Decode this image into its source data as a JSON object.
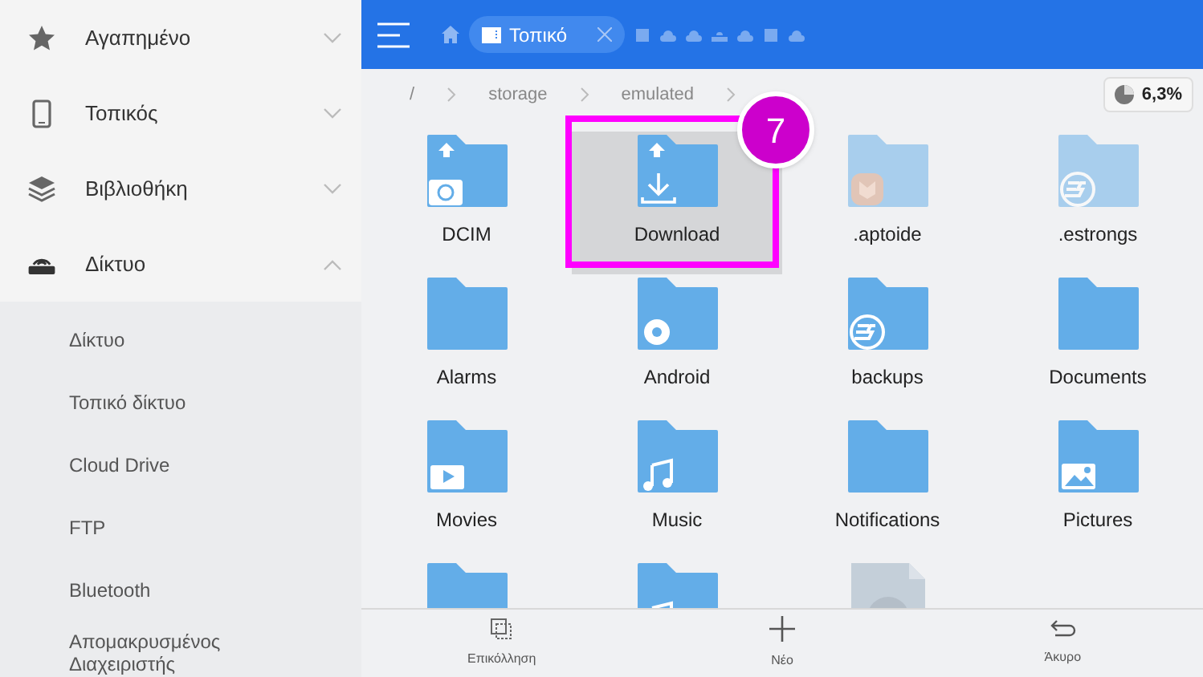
{
  "sidebar": {
    "items": [
      {
        "label": "Αγαπημένο",
        "kind": "star",
        "expanded": false
      },
      {
        "label": "Τοπικός",
        "kind": "phone",
        "expanded": false
      },
      {
        "label": "Βιβλιοθήκη",
        "kind": "layers",
        "expanded": false
      },
      {
        "label": "Δίκτυο",
        "kind": "router",
        "expanded": true,
        "children": [
          {
            "label": "Δίκτυο"
          },
          {
            "label": "Τοπικό δίκτυο"
          },
          {
            "label": "Cloud Drive"
          },
          {
            "label": "FTP"
          },
          {
            "label": "Bluetooth"
          },
          {
            "label": "Απομακρυσμένος Διαχειριστής"
          }
        ]
      }
    ]
  },
  "tab": {
    "label": "Τοπικό"
  },
  "breadcrumb": [
    "/",
    "storage",
    "emulated"
  ],
  "storage_badge": "6,3%",
  "files": [
    {
      "name": "DCIM",
      "kind": "camera",
      "upload": true,
      "hidden": false,
      "selected": false
    },
    {
      "name": "Download",
      "kind": "download",
      "upload": true,
      "hidden": false,
      "selected": true
    },
    {
      "name": ".aptoide",
      "kind": "aptoide",
      "upload": false,
      "hidden": true,
      "selected": false
    },
    {
      "name": ".estrongs",
      "kind": "es",
      "upload": false,
      "hidden": true,
      "selected": false
    },
    {
      "name": "Alarms",
      "kind": "plain",
      "upload": false,
      "hidden": false,
      "selected": false
    },
    {
      "name": "Android",
      "kind": "gear",
      "upload": false,
      "hidden": false,
      "selected": false
    },
    {
      "name": "backups",
      "kind": "es",
      "upload": false,
      "hidden": false,
      "selected": false
    },
    {
      "name": "Documents",
      "kind": "plain",
      "upload": false,
      "hidden": false,
      "selected": false
    },
    {
      "name": "Movies",
      "kind": "video",
      "upload": false,
      "hidden": false,
      "selected": false
    },
    {
      "name": "Music",
      "kind": "music",
      "upload": false,
      "hidden": false,
      "selected": false
    },
    {
      "name": "Notifications",
      "kind": "plain",
      "upload": false,
      "hidden": false,
      "selected": false
    },
    {
      "name": "Pictures",
      "kind": "image",
      "upload": false,
      "hidden": false,
      "selected": false
    },
    {
      "kind": "plain",
      "upload": false,
      "hidden": false,
      "selected": false
    },
    {
      "kind": "music",
      "upload": false,
      "hidden": false,
      "selected": false
    },
    {
      "kind": "unknown",
      "upload": false,
      "hidden": true,
      "selected": false
    }
  ],
  "callout": {
    "number": "7"
  },
  "toolbar": [
    {
      "label": "Επικόλληση",
      "kind": "paste"
    },
    {
      "label": "Νέο",
      "kind": "plus"
    },
    {
      "label": "Άκυρο",
      "kind": "undo"
    }
  ]
}
